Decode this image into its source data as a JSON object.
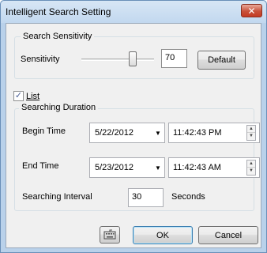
{
  "window": {
    "title": "Intelligent Search Setting",
    "close_glyph": "✕"
  },
  "sensitivity_group": {
    "legend": "Search Sensitivity",
    "label": "Sensitivity",
    "value": "70",
    "level": 70,
    "default_label": "Default"
  },
  "list": {
    "label": "List",
    "checked": true,
    "check_glyph": "✓"
  },
  "duration_group": {
    "legend": "Searching Duration",
    "begin_label": "Begin Time",
    "begin_date": "5/22/2012",
    "begin_time": "11:42:43 PM",
    "end_label": "End Time",
    "end_date": "5/23/2012",
    "end_time": "11:42:43 AM",
    "interval_label": "Searching Interval",
    "interval_value": "30",
    "interval_unit": "Seconds"
  },
  "footer": {
    "ok_label": "OK",
    "cancel_label": "Cancel",
    "keyboard_icon": "keyboard-icon"
  },
  "glyphs": {
    "dropdown": "▼",
    "spin_up": "▲",
    "spin_down": "▼"
  }
}
